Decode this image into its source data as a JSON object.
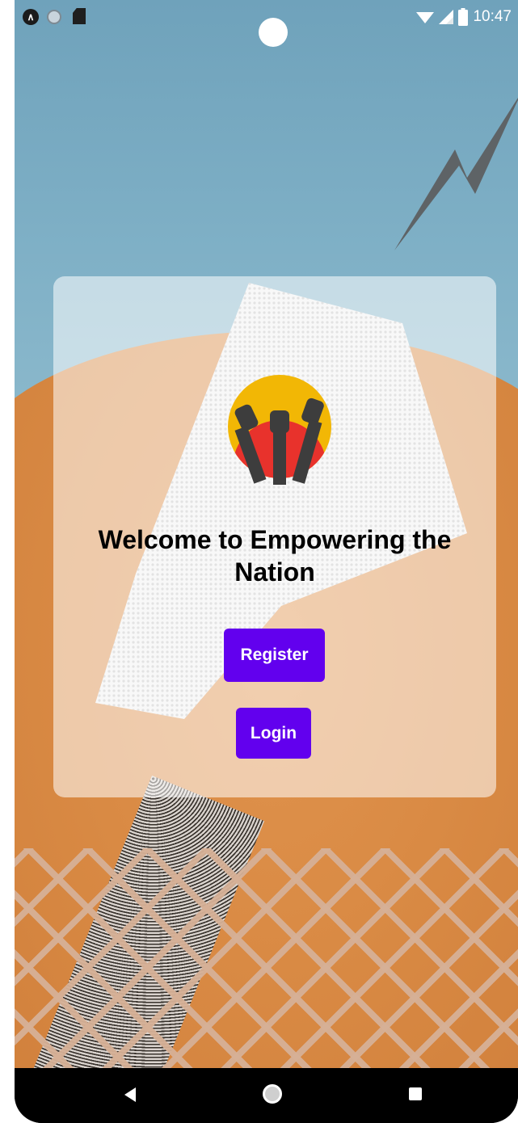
{
  "status_bar": {
    "time": "10:47",
    "left_icons": [
      "app-a-icon",
      "circle-notification-icon",
      "sd-card-icon"
    ],
    "right_icons": [
      "wifi-icon",
      "cell-signal-icon",
      "battery-icon"
    ]
  },
  "card": {
    "logo": "raised-fists-logo",
    "title": "Welcome to Empowering the Nation",
    "register_label": "Register",
    "login_label": "Login"
  },
  "nav_bar": {
    "items": [
      "back-icon",
      "home-icon",
      "recent-apps-icon"
    ]
  },
  "colors": {
    "primary_button": "#6200ee",
    "button_text": "#ffffff",
    "card_background": "rgba(255,255,255,0.55)",
    "logo_yellow": "#f2b705",
    "logo_red": "#e8322c"
  }
}
